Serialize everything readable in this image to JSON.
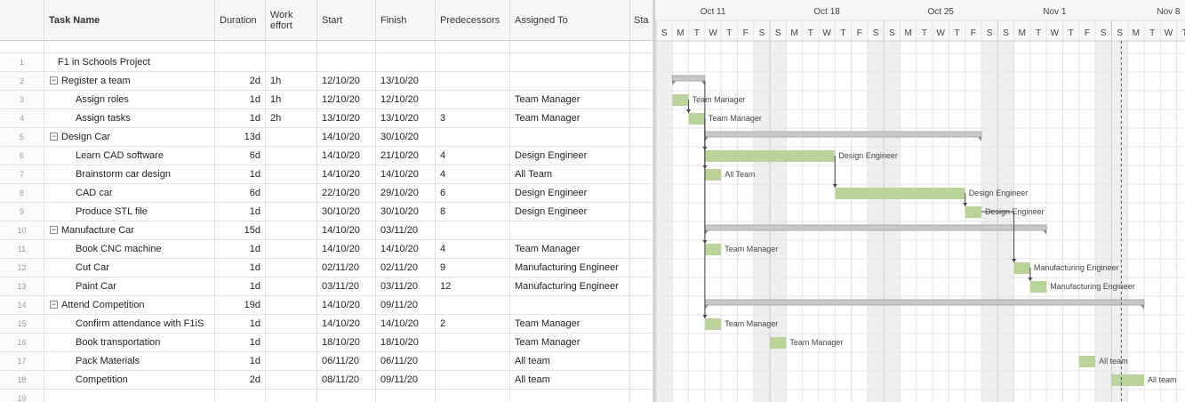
{
  "columns": {
    "task_name": "Task Name",
    "duration": "Duration",
    "work_effort_1": "Work",
    "work_effort_2": "effort",
    "start": "Start",
    "finish": "Finish",
    "predecessors": "Predecessors",
    "assigned_to": "Assigned To",
    "status": "Sta"
  },
  "rows": [
    {
      "n": "1",
      "name": "F1 in Schools Project",
      "dur": "",
      "effort": "",
      "start": "",
      "finish": "",
      "pred": "",
      "assigned": "",
      "level": 0,
      "parent": false
    },
    {
      "n": "2",
      "name": "Register a team",
      "dur": "2d",
      "effort": "1h",
      "start": "12/10/20",
      "finish": "13/10/20",
      "pred": "",
      "assigned": "",
      "level": 1,
      "parent": true
    },
    {
      "n": "3",
      "name": "Assign roles",
      "dur": "1d",
      "effort": "1h",
      "start": "12/10/20",
      "finish": "12/10/20",
      "pred": "",
      "assigned": "Team Manager",
      "level": 2,
      "parent": false
    },
    {
      "n": "4",
      "name": "Assign tasks",
      "dur": "1d",
      "effort": "2h",
      "start": "13/10/20",
      "finish": "13/10/20",
      "pred": "3",
      "assigned": "Team Manager",
      "level": 2,
      "parent": false
    },
    {
      "n": "5",
      "name": "Design Car",
      "dur": "13d",
      "effort": "",
      "start": "14/10/20",
      "finish": "30/10/20",
      "pred": "",
      "assigned": "",
      "level": 1,
      "parent": true
    },
    {
      "n": "6",
      "name": "Learn CAD software",
      "dur": "6d",
      "effort": "",
      "start": "14/10/20",
      "finish": "21/10/20",
      "pred": "4",
      "assigned": "Design Engineer",
      "level": 2,
      "parent": false
    },
    {
      "n": "7",
      "name": "Brainstorm car design",
      "dur": "1d",
      "effort": "",
      "start": "14/10/20",
      "finish": "14/10/20",
      "pred": "4",
      "assigned": "All Team",
      "level": 2,
      "parent": false
    },
    {
      "n": "8",
      "name": "CAD car",
      "dur": "6d",
      "effort": "",
      "start": "22/10/20",
      "finish": "29/10/20",
      "pred": "6",
      "assigned": "Design Engineer",
      "level": 2,
      "parent": false
    },
    {
      "n": "9",
      "name": "Produce STL file",
      "dur": "1d",
      "effort": "",
      "start": "30/10/20",
      "finish": "30/10/20",
      "pred": "8",
      "assigned": "Design Engineer",
      "level": 2,
      "parent": false
    },
    {
      "n": "10",
      "name": "Manufacture Car",
      "dur": "15d",
      "effort": "",
      "start": "14/10/20",
      "finish": "03/11/20",
      "pred": "",
      "assigned": "",
      "level": 1,
      "parent": true
    },
    {
      "n": "11",
      "name": "Book CNC machine",
      "dur": "1d",
      "effort": "",
      "start": "14/10/20",
      "finish": "14/10/20",
      "pred": "4",
      "assigned": "Team Manager",
      "level": 2,
      "parent": false
    },
    {
      "n": "12",
      "name": "Cut Car",
      "dur": "1d",
      "effort": "",
      "start": "02/11/20",
      "finish": "02/11/20",
      "pred": "9",
      "assigned": "Manufacturing Engineer",
      "level": 2,
      "parent": false
    },
    {
      "n": "13",
      "name": "Paint Car",
      "dur": "1d",
      "effort": "",
      "start": "03/11/20",
      "finish": "03/11/20",
      "pred": "12",
      "assigned": "Manufacturing Engineer",
      "level": 2,
      "parent": false
    },
    {
      "n": "14",
      "name": "Attend Competition",
      "dur": "19d",
      "effort": "",
      "start": "14/10/20",
      "finish": "09/11/20",
      "pred": "",
      "assigned": "",
      "level": 1,
      "parent": true
    },
    {
      "n": "15",
      "name": "Confirm attendance with F1iS",
      "dur": "1d",
      "effort": "",
      "start": "14/10/20",
      "finish": "14/10/20",
      "pred": "2",
      "assigned": "Team Manager",
      "level": 2,
      "parent": false
    },
    {
      "n": "16",
      "name": "Book transportation",
      "dur": "1d",
      "effort": "",
      "start": "18/10/20",
      "finish": "18/10/20",
      "pred": "",
      "assigned": "Team Manager",
      "level": 2,
      "parent": false
    },
    {
      "n": "17",
      "name": "Pack Materials",
      "dur": "1d",
      "effort": "",
      "start": "06/11/20",
      "finish": "06/11/20",
      "pred": "",
      "assigned": "All team",
      "level": 2,
      "parent": false
    },
    {
      "n": "18",
      "name": "Competition",
      "dur": "2d",
      "effort": "",
      "start": "08/11/20",
      "finish": "09/11/20",
      "pred": "",
      "assigned": "All team",
      "level": 2,
      "parent": false
    },
    {
      "n": "19",
      "name": "",
      "dur": "",
      "effort": "",
      "start": "",
      "finish": "",
      "pred": "",
      "assigned": "",
      "level": 0,
      "parent": false
    }
  ],
  "gantt": {
    "weeks": [
      "Oct 11",
      "Oct 18",
      "Oct 25",
      "Nov 1",
      "Nov 8"
    ],
    "day_letters": [
      "S",
      "M",
      "T",
      "W",
      "T",
      "F",
      "S"
    ],
    "bar_labels": {
      "3": "Team Manager",
      "4": "Team Manager",
      "6": "Design Engineer",
      "7": "All Team",
      "8": "Design Engineer",
      "9": "Design Engineer",
      "11": "Team Manager",
      "12": "Manufacturing Engineer",
      "13": "Manufacturing Engineer",
      "15": "Team Manager",
      "16": "Team Manager",
      "17": "All team",
      "18": "All team"
    },
    "colors": {
      "task_bar": "#b9d39a",
      "summary_bar": "#c8c8c8",
      "weekend": "#efefef",
      "today_line": "#555555"
    }
  }
}
